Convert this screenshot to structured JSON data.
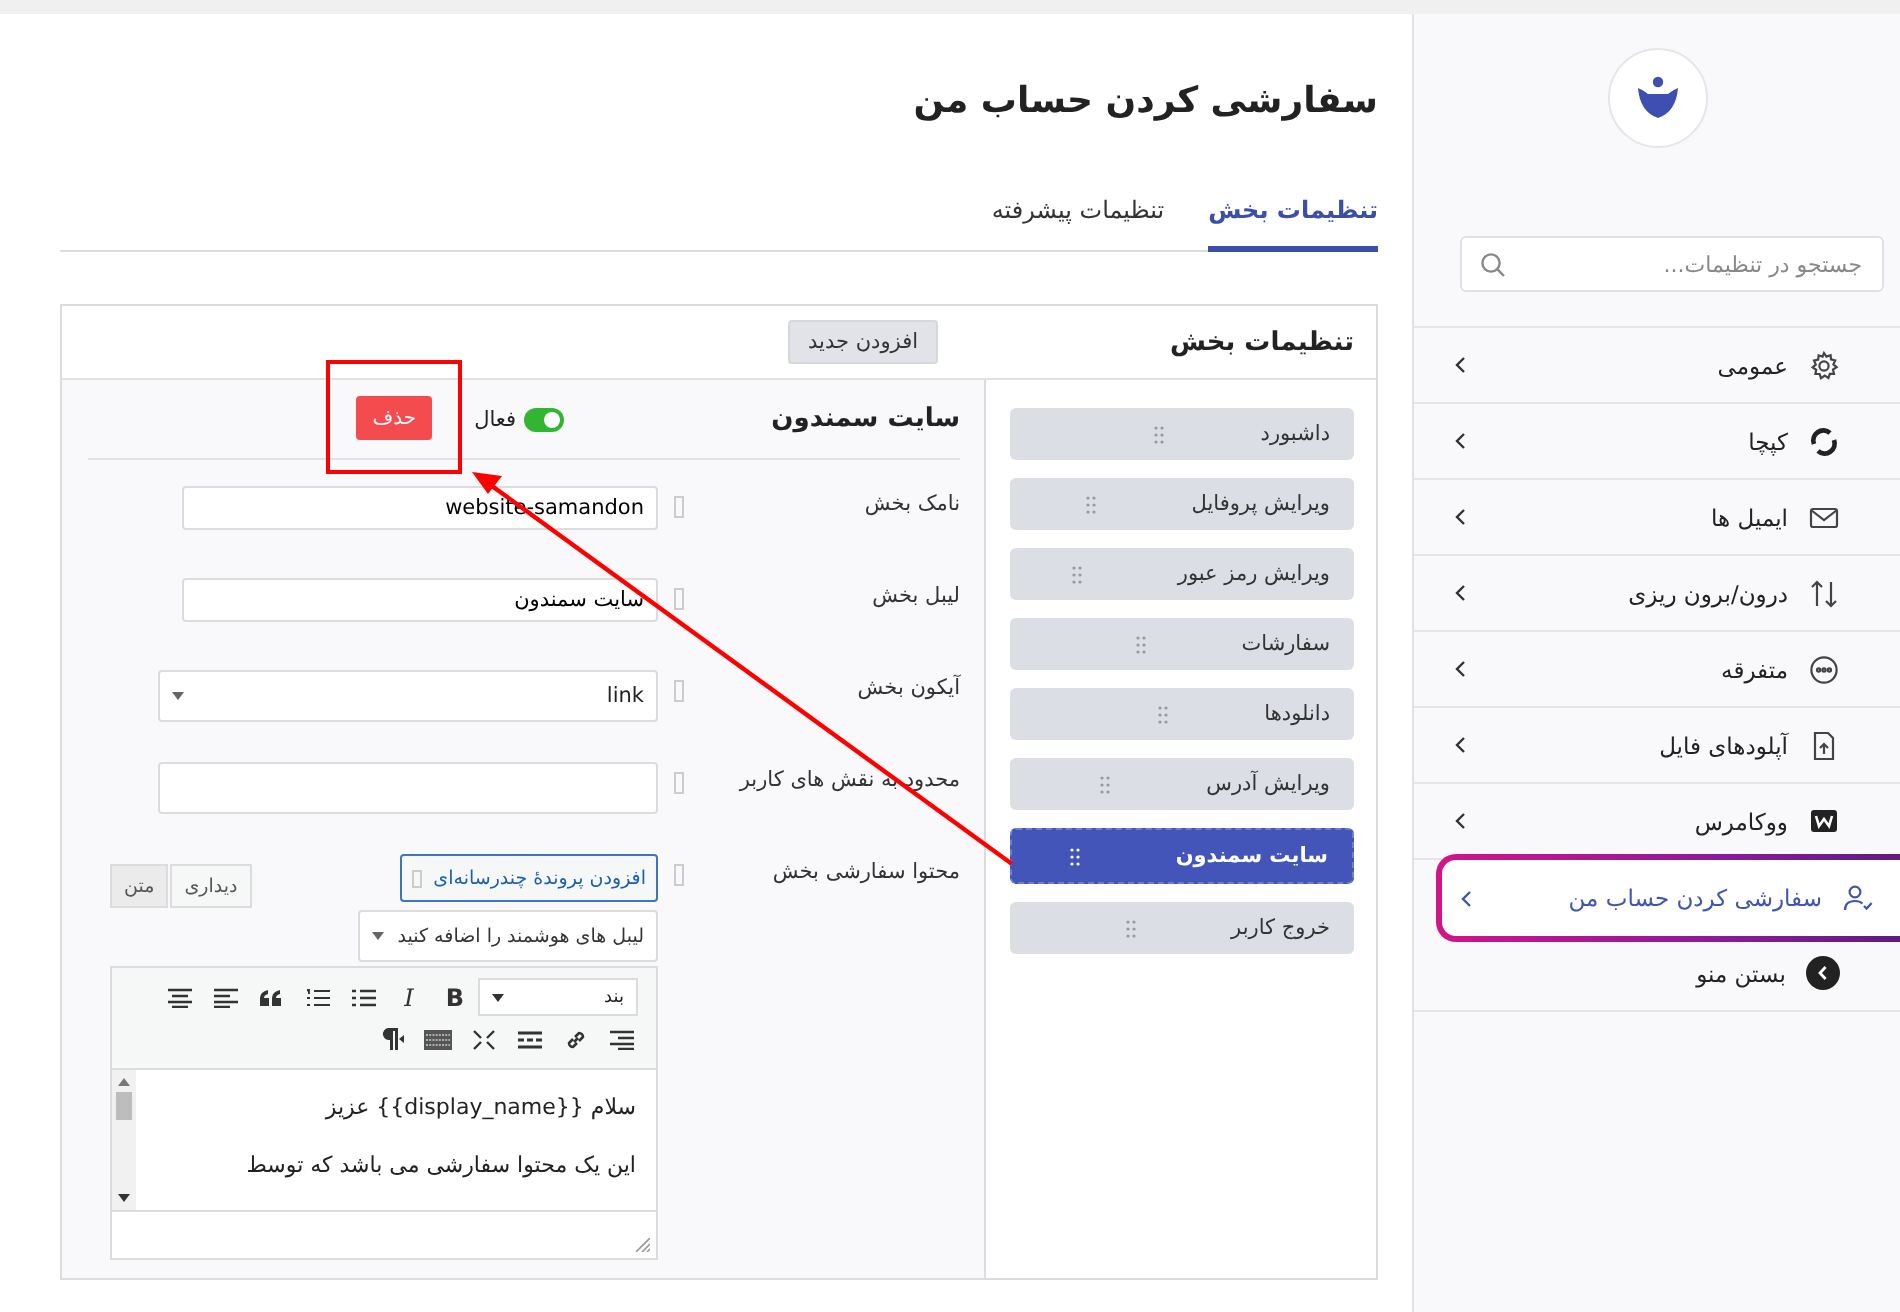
{
  "sidebar": {
    "search": {
      "placeholder": "جستجو در تنظیمات..."
    },
    "items": [
      {
        "label": "عمومی",
        "selected": false,
        "highlighted": false
      },
      {
        "label": "کپچا",
        "selected": false,
        "highlighted": false
      },
      {
        "label": "ایمیل ها",
        "selected": false,
        "highlighted": false
      },
      {
        "label": "درون/برون ریزی",
        "selected": false,
        "highlighted": false
      },
      {
        "label": "متفرقه",
        "selected": false,
        "highlighted": false
      },
      {
        "label": "آپلودهای فایل",
        "selected": false,
        "highlighted": false
      },
      {
        "label": "ووکامرس",
        "selected": false,
        "highlighted": false
      },
      {
        "label": "سفارشی کردن حساب من",
        "selected": true,
        "highlighted": true
      }
    ],
    "collapse": {
      "label": "بستن منو"
    }
  },
  "page": {
    "title": "سفارشی کردن حساب من"
  },
  "tabs": [
    {
      "label": "تنظیمات بخش",
      "selected": true
    },
    {
      "label": "تنظیمات پیشرفته",
      "selected": false
    }
  ],
  "card": {
    "title": "تنظیمات بخش",
    "add_button": "افزودن جدید",
    "sections": [
      {
        "label": "داشبورد",
        "selected": false
      },
      {
        "label": "ویرایش پروفایل",
        "selected": false
      },
      {
        "label": "ویرایش رمز عبور",
        "selected": false
      },
      {
        "label": "سفارشات",
        "selected": false
      },
      {
        "label": "دانلودها",
        "selected": false
      },
      {
        "label": "ویرایش آدرس",
        "selected": false
      },
      {
        "label": "سایت سمندون",
        "selected": true
      },
      {
        "label": "خروج کاربر",
        "selected": false
      }
    ],
    "editor": {
      "title": "سایت سمندون",
      "active": true,
      "active_label": "فعال",
      "delete_label": "حذف",
      "delete_highlighted": true,
      "fields": [
        {
          "kind": "text",
          "label": "نامک بخش",
          "value": "website-samandon"
        },
        {
          "kind": "text",
          "label": "لیبل بخش",
          "value": "سایت سمندون"
        },
        {
          "kind": "select",
          "label": "آیکون بخش",
          "value": "link"
        },
        {
          "kind": "text",
          "label": "محدود به نقش های کاربر"
        },
        {
          "kind": "content",
          "label": "محتوا سفارشی بخش"
        }
      ],
      "media_button": "افزودن پروندهٔ چندرسانه‌ای",
      "mode_tabs": [
        {
          "label": "دیداری",
          "selected": true
        },
        {
          "label": "متن",
          "selected": false
        }
      ],
      "smart_labels": {
        "placeholder": "لیبل های هوشمند را اضافه کنید"
      },
      "toolbar": {
        "format": "بند",
        "bold": "B",
        "italic": "I"
      },
      "lines": [
        "سلام {{display_name}} عزیز",
        "این یک محتوا سفارشی می باشد که توسط"
      ]
    }
  }
}
